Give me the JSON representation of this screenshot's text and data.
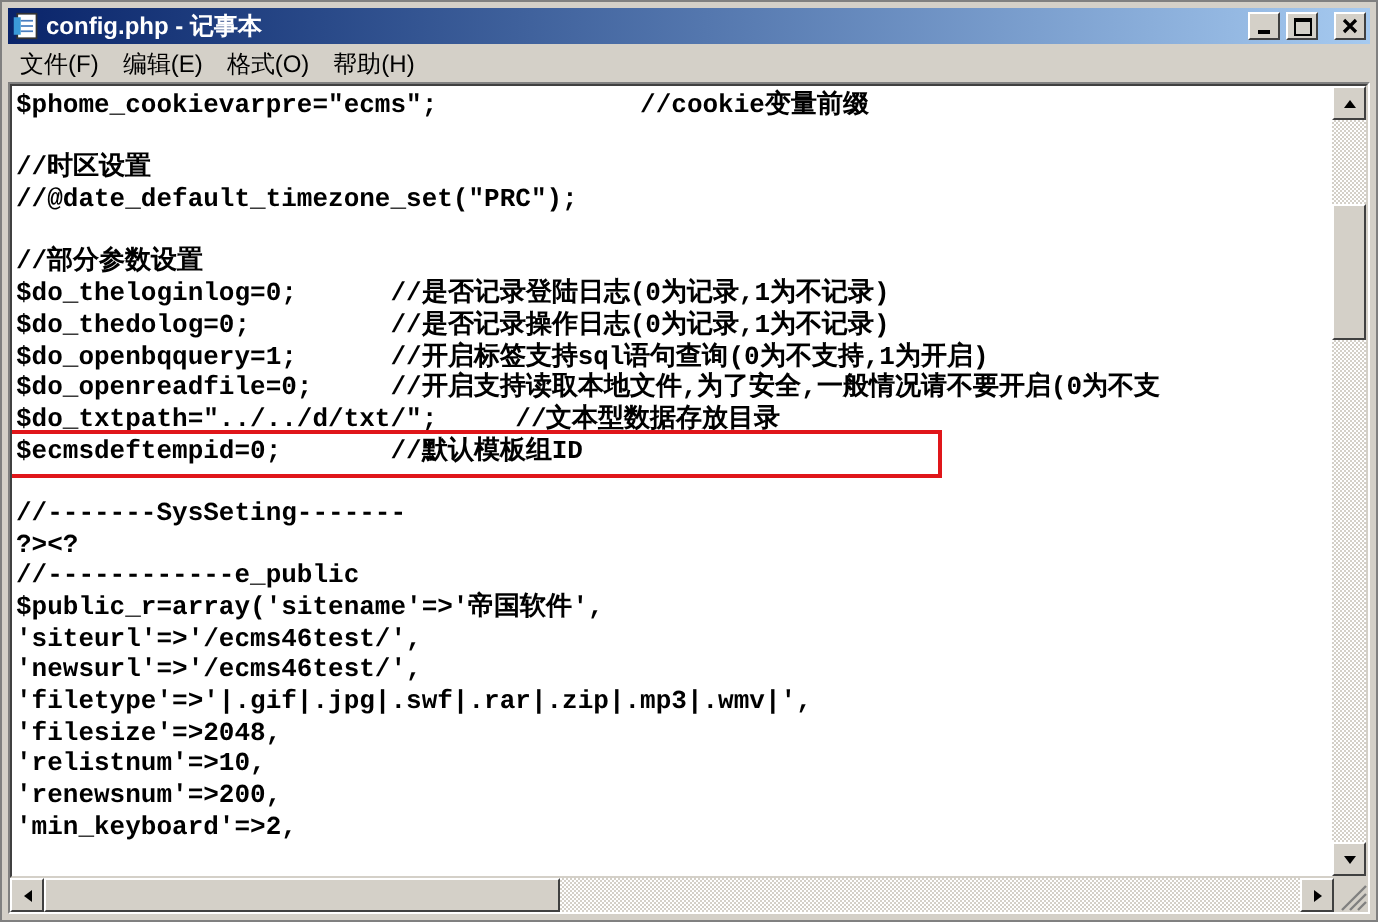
{
  "window": {
    "title": "config.php - 记事本"
  },
  "menu": [
    {
      "label": "文件(F)"
    },
    {
      "label": "编辑(E)"
    },
    {
      "label": "格式(O)"
    },
    {
      "label": "帮助(H)"
    }
  ],
  "lines": [
    {
      "kind": "code",
      "text": "$phome_cookievarpre=\"ecms\";             //cookie变量前缀",
      "highlighted": false
    },
    {
      "kind": "blank"
    },
    {
      "kind": "code",
      "text": "//时区设置",
      "highlighted": false
    },
    {
      "kind": "code",
      "text": "//@date_default_timezone_set(\"PRC\");",
      "highlighted": false
    },
    {
      "kind": "blank"
    },
    {
      "kind": "code",
      "text": "//部分参数设置",
      "highlighted": false
    },
    {
      "kind": "code",
      "text": "$do_theloginlog=0;      //是否记录登陆日志(0为记录,1为不记录)",
      "highlighted": false
    },
    {
      "kind": "code",
      "text": "$do_thedolog=0;         //是否记录操作日志(0为记录,1为不记录)",
      "highlighted": false
    },
    {
      "kind": "code",
      "text": "$do_openbqquery=1;      //开启标签支持sql语句查询(0为不支持,1为开启)",
      "highlighted": false
    },
    {
      "kind": "code",
      "text": "$do_openreadfile=0;     //开启支持读取本地文件,为了安全,一般情况请不要开启(0为不支",
      "highlighted": false
    },
    {
      "kind": "code",
      "text": "$do_txtpath=\"../../d/txt/\";     //文本型数据存放目录",
      "highlighted": false
    },
    {
      "kind": "code",
      "text": "$ecmsdeftempid=0;       //默认模板组ID",
      "highlighted": true
    },
    {
      "kind": "blank"
    },
    {
      "kind": "code",
      "text": "//-------SysSeting-------",
      "highlighted": false
    },
    {
      "kind": "code",
      "text": "?><?",
      "highlighted": false
    },
    {
      "kind": "code",
      "text": "//------------e_public",
      "highlighted": false
    },
    {
      "kind": "code",
      "text": "$public_r=array('sitename'=>'帝国软件',",
      "highlighted": false
    },
    {
      "kind": "code",
      "text": "'siteurl'=>'/ecms46test/',",
      "highlighted": false
    },
    {
      "kind": "code",
      "text": "'newsurl'=>'/ecms46test/',",
      "highlighted": false
    },
    {
      "kind": "code",
      "text": "'filetype'=>'|.gif|.jpg|.swf|.rar|.zip|.mp3|.wmv|',",
      "highlighted": false
    },
    {
      "kind": "code",
      "text": "'filesize'=>2048,",
      "highlighted": false
    },
    {
      "kind": "code",
      "text": "'relistnum'=>10,",
      "highlighted": false
    },
    {
      "kind": "code",
      "text": "'renewsnum'=>200,",
      "highlighted": false
    },
    {
      "kind": "code",
      "text": "'min_keyboard'=>2,",
      "highlighted": false
    }
  ]
}
